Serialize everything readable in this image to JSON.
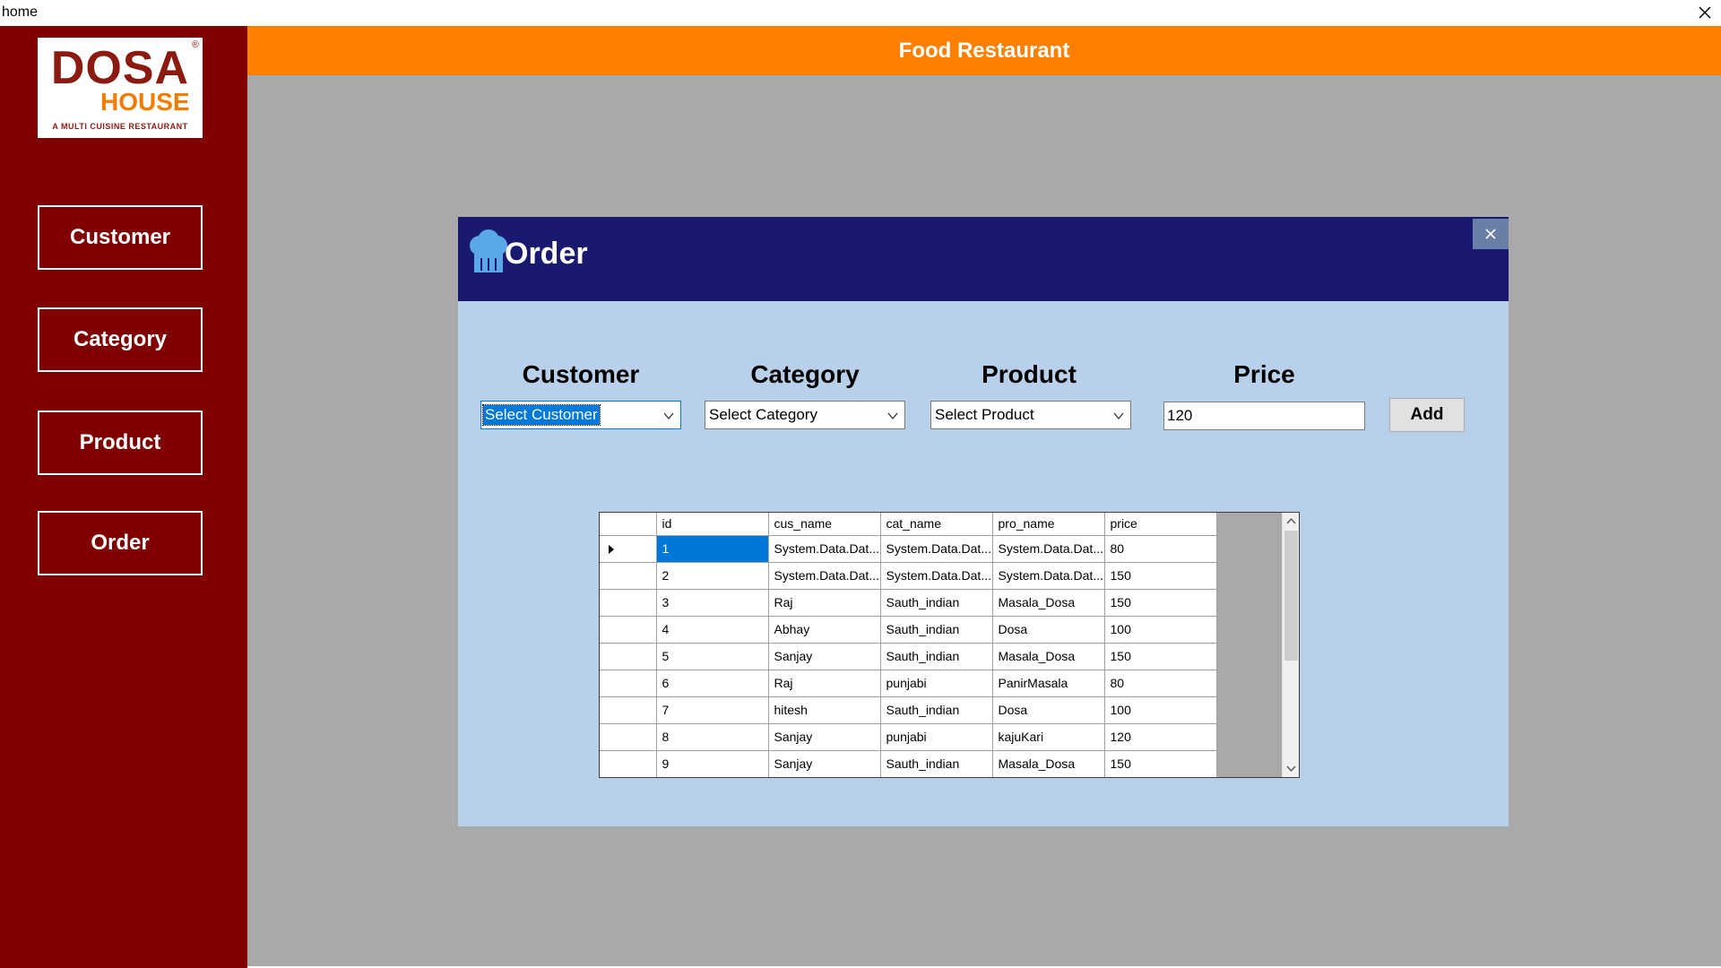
{
  "window": {
    "title": "home"
  },
  "app": {
    "title": "Food Restaurant"
  },
  "logo": {
    "brand_part1": "DOSA",
    "brand_part2": "HOUSE",
    "tagline": "A MULTI CUISINE RESTAURANT",
    "registered": "®"
  },
  "sidebar": {
    "items": [
      {
        "label": "Customer"
      },
      {
        "label": "Category"
      },
      {
        "label": "Product"
      },
      {
        "label": "Order"
      }
    ]
  },
  "dialog": {
    "title": "Order",
    "fields": {
      "customer_label": "Customer",
      "category_label": "Category",
      "product_label": "Product",
      "price_label": "Price",
      "customer_value": "Select Customer",
      "category_value": "Select Category",
      "product_value": "Select Product",
      "price_value": "120"
    },
    "add_label": "Add"
  },
  "grid": {
    "columns": [
      "id",
      "cus_name",
      "cat_name",
      "pro_name",
      "price"
    ],
    "rows": [
      [
        "1",
        "System.Data.Dat...",
        "System.Data.Dat...",
        "System.Data.Dat...",
        "80"
      ],
      [
        "2",
        "System.Data.Dat...",
        "System.Data.Dat...",
        "System.Data.Dat...",
        "150"
      ],
      [
        "3",
        "Raj",
        "Sauth_indian",
        "Masala_Dosa",
        "150"
      ],
      [
        "4",
        "Abhay",
        "Sauth_indian",
        "Dosa",
        "100"
      ],
      [
        "5",
        "Sanjay",
        "Sauth_indian",
        "Masala_Dosa",
        "150"
      ],
      [
        "6",
        "Raj",
        "punjabi",
        "PanirMasala",
        "80"
      ],
      [
        "7",
        "hitesh",
        "Sauth_indian",
        "Dosa",
        "100"
      ],
      [
        "8",
        "Sanjay",
        "punjabi",
        "kajuKari",
        "120"
      ],
      [
        "9",
        "Sanjay",
        "Sauth_indian",
        "Masala_Dosa",
        "150"
      ]
    ]
  },
  "colors": {
    "sidebar_bg": "#7f0000",
    "topbar_bg": "#ff7f00",
    "workarea_bg": "#a9a9a9",
    "dialog_bg": "#b8d0ea",
    "dialog_header_bg": "#191970",
    "selection": "#0078d7"
  },
  "icons": {
    "dialog_icon": "chef-hat-icon",
    "close": "close-icon",
    "dropdown": "chevron-down-icon"
  }
}
